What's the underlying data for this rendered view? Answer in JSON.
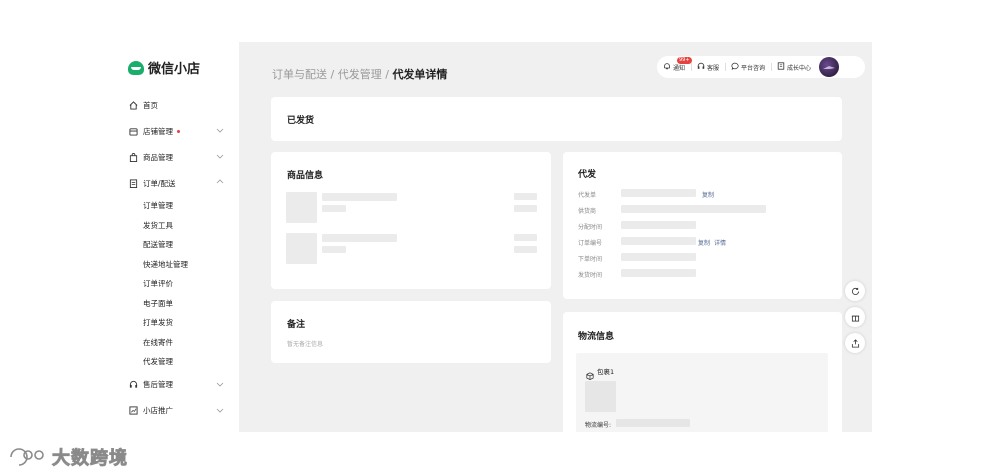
{
  "app": {
    "name": "微信小店"
  },
  "sidebar": {
    "items": [
      {
        "label": "首页",
        "icon": "home-icon"
      },
      {
        "label": "店铺管理",
        "icon": "store-icon",
        "has_dot": true
      },
      {
        "label": "商品管理",
        "icon": "bag-icon"
      },
      {
        "label": "订单/配送",
        "icon": "order-icon",
        "expanded": true
      }
    ],
    "sub_items": [
      "订单管理",
      "发货工具",
      "配送管理",
      "快递地址管理",
      "订单评价",
      "电子面单",
      "打单发货",
      "在线寄件",
      "代发管理"
    ],
    "bottom_items": [
      {
        "label": "售后管理",
        "icon": "headset-icon"
      },
      {
        "label": "小店推广",
        "icon": "chart-icon"
      }
    ]
  },
  "breadcrumb": {
    "part1": "订单与配送",
    "sep": "/",
    "part2": "代发管理",
    "current": "代发单详情"
  },
  "topbar": {
    "notify_label": "通知",
    "notify_badge": "99+",
    "service_label": "客服",
    "consult_label": "平台咨询",
    "growth_label": "成长中心"
  },
  "status_card": {
    "title": "已发货"
  },
  "product_card": {
    "title": "商品信息"
  },
  "remark_card": {
    "title": "备注",
    "empty": "暂无备注信息"
  },
  "dropship_card": {
    "title": "代发",
    "fields": [
      "代发单",
      "供货商",
      "分配时间",
      "订单编号",
      "下单时间",
      "发货时间"
    ],
    "copy_label": "复制",
    "detail_label": "详情"
  },
  "logistics_card": {
    "title": "物流信息",
    "package_label": "包裹1",
    "tracking_label": "物流编号:"
  },
  "watermark": {
    "text": "大数跨境"
  },
  "colors": {
    "brand": "#1aad6b",
    "link": "#576b95",
    "badge": "#e64340",
    "bg": "#f0f0f0"
  }
}
